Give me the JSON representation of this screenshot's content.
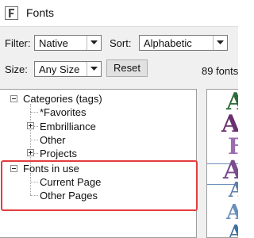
{
  "window": {
    "title": "Fonts",
    "icon": "fonts-app-icon"
  },
  "filters": {
    "filter_label": "Filter:",
    "filter_value": "Native",
    "sort_label": "Sort:",
    "sort_value": "Alphabetic",
    "size_label": "Size:",
    "size_value": "Any Size",
    "reset_label": "Reset",
    "count_text": "89 fonts"
  },
  "tree": {
    "categories": {
      "label": "Categories (tags)",
      "expanded": true,
      "children": [
        {
          "label": "*Favorites",
          "has_children": false
        },
        {
          "label": "Embrilliance",
          "has_children": true
        },
        {
          "label": "Other",
          "has_children": false
        },
        {
          "label": "Projects",
          "has_children": true
        }
      ]
    },
    "fonts_in_use": {
      "label": "Fonts in use",
      "expanded": true,
      "children": [
        {
          "label": "Current Page"
        },
        {
          "label": "Other Pages"
        }
      ]
    }
  },
  "preview": {
    "glyphs": [
      "A",
      "A",
      "F",
      "A",
      "A",
      "A",
      "A"
    ],
    "colors": [
      "#2e6b3a",
      "#6b2e6e",
      "#9b6bb0",
      "#7a4b8f",
      "#5d7fa8",
      "#6a8fb8",
      "#3e6f9e"
    ]
  },
  "accent": {
    "highlight": "#e53c3c",
    "selection_line": "#6f92b8"
  }
}
